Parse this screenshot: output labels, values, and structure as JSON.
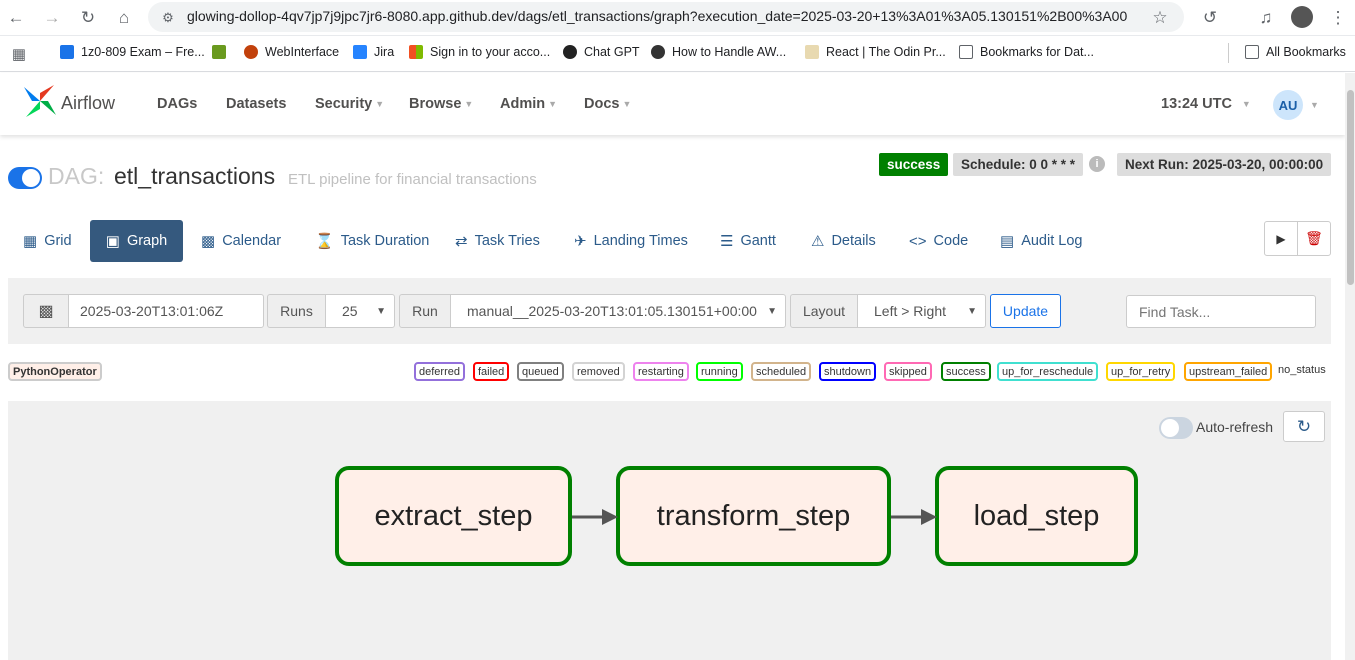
{
  "browser": {
    "url": "glowing-dollop-4qv7jp7j9jpc7jr6-8080.app.github.dev/dags/etl_transactions/graph?execution_date=2025-03-20+13%3A01%3A05.130151%2B00%3A00",
    "bookmarks": [
      "1z0-809 Exam – Fre...",
      "WebInterface",
      "Jira",
      "Sign in to your acco...",
      "Chat GPT",
      "How to Handle AW...",
      "React | The Odin Pr...",
      "Bookmarks for Dat..."
    ],
    "all_bookmarks": "All Bookmarks"
  },
  "nav": {
    "brand": "Airflow",
    "items": [
      "DAGs",
      "Datasets",
      "Security",
      "Browse",
      "Admin",
      "Docs"
    ],
    "time": "13:24 UTC",
    "user_initials": "AU"
  },
  "dag": {
    "prefix": "DAG:",
    "id": "etl_transactions",
    "description": "ETL pipeline for financial transactions",
    "paused": false,
    "state": "success",
    "schedule": "Schedule: 0 0 * * *",
    "next_run": "Next Run: 2025-03-20, 00:00:00"
  },
  "tabs": [
    "Grid",
    "Graph",
    "Calendar",
    "Task Duration",
    "Task Tries",
    "Landing Times",
    "Gantt",
    "Details",
    "Code",
    "Audit Log"
  ],
  "active_tab": "Graph",
  "controls": {
    "base_date": "2025-03-20T13:01:06Z",
    "runs_label": "Runs",
    "runs_value": "25",
    "run_label": "Run",
    "run_value": "manual__2025-03-20T13:01:05.130151+00:00",
    "layout_label": "Layout",
    "layout_value": "Left > Right",
    "update_label": "Update",
    "find_placeholder": "Find Task..."
  },
  "operator_legend": "PythonOperator",
  "state_legend": [
    {
      "label": "deferred",
      "color": "#9370db"
    },
    {
      "label": "failed",
      "color": "#ff0000"
    },
    {
      "label": "queued",
      "color": "#808080"
    },
    {
      "label": "removed",
      "color": "#d3d3d3"
    },
    {
      "label": "restarting",
      "color": "#ee82ee"
    },
    {
      "label": "running",
      "color": "#00ff00"
    },
    {
      "label": "scheduled",
      "color": "#d2b48c"
    },
    {
      "label": "shutdown",
      "color": "#0000ff"
    },
    {
      "label": "skipped",
      "color": "#ff69b4"
    },
    {
      "label": "success",
      "color": "#008000"
    },
    {
      "label": "up_for_reschedule",
      "color": "#40e0d0"
    },
    {
      "label": "up_for_retry",
      "color": "#ffd700"
    },
    {
      "label": "upstream_failed",
      "color": "#ffa500"
    },
    {
      "label": "no_status",
      "color": "#ffffff"
    }
  ],
  "graph": {
    "auto_refresh_label": "Auto-refresh",
    "auto_refresh_on": false,
    "tasks": [
      "extract_step",
      "transform_step",
      "load_step"
    ],
    "task_state_color": "#008000",
    "task_fill_color": "#ffefe8"
  }
}
